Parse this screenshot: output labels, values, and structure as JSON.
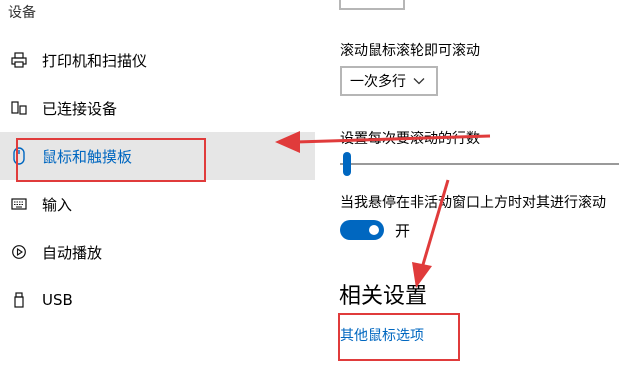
{
  "sidebar": {
    "header": "设备",
    "items": [
      {
        "label": "打印机和扫描仪",
        "icon": "printer-icon"
      },
      {
        "label": "已连接设备",
        "icon": "connected-devices-icon"
      },
      {
        "label": "鼠标和触摸板",
        "icon": "mouse-icon",
        "selected": true
      },
      {
        "label": "输入",
        "icon": "keyboard-icon"
      },
      {
        "label": "自动播放",
        "icon": "autoplay-icon"
      },
      {
        "label": "USB",
        "icon": "usb-icon"
      }
    ]
  },
  "main": {
    "scroll_label": "滚动鼠标滚轮即可滚动",
    "scroll_dropdown_value": "一次多行",
    "lines_label": "设置每次要滚动的行数",
    "lines_slider_value": 0.03,
    "inactive_scroll_label": "当我悬停在非活动窗口上方时对其进行滚动",
    "toggle_state": "开",
    "toggle_on": true,
    "related_heading": "相关设置",
    "other_mouse_link": "其他鼠标选项"
  },
  "colors": {
    "accent": "#0067c0",
    "annotation": "#e03b3b",
    "selected_bg": "#e6e6e6"
  }
}
